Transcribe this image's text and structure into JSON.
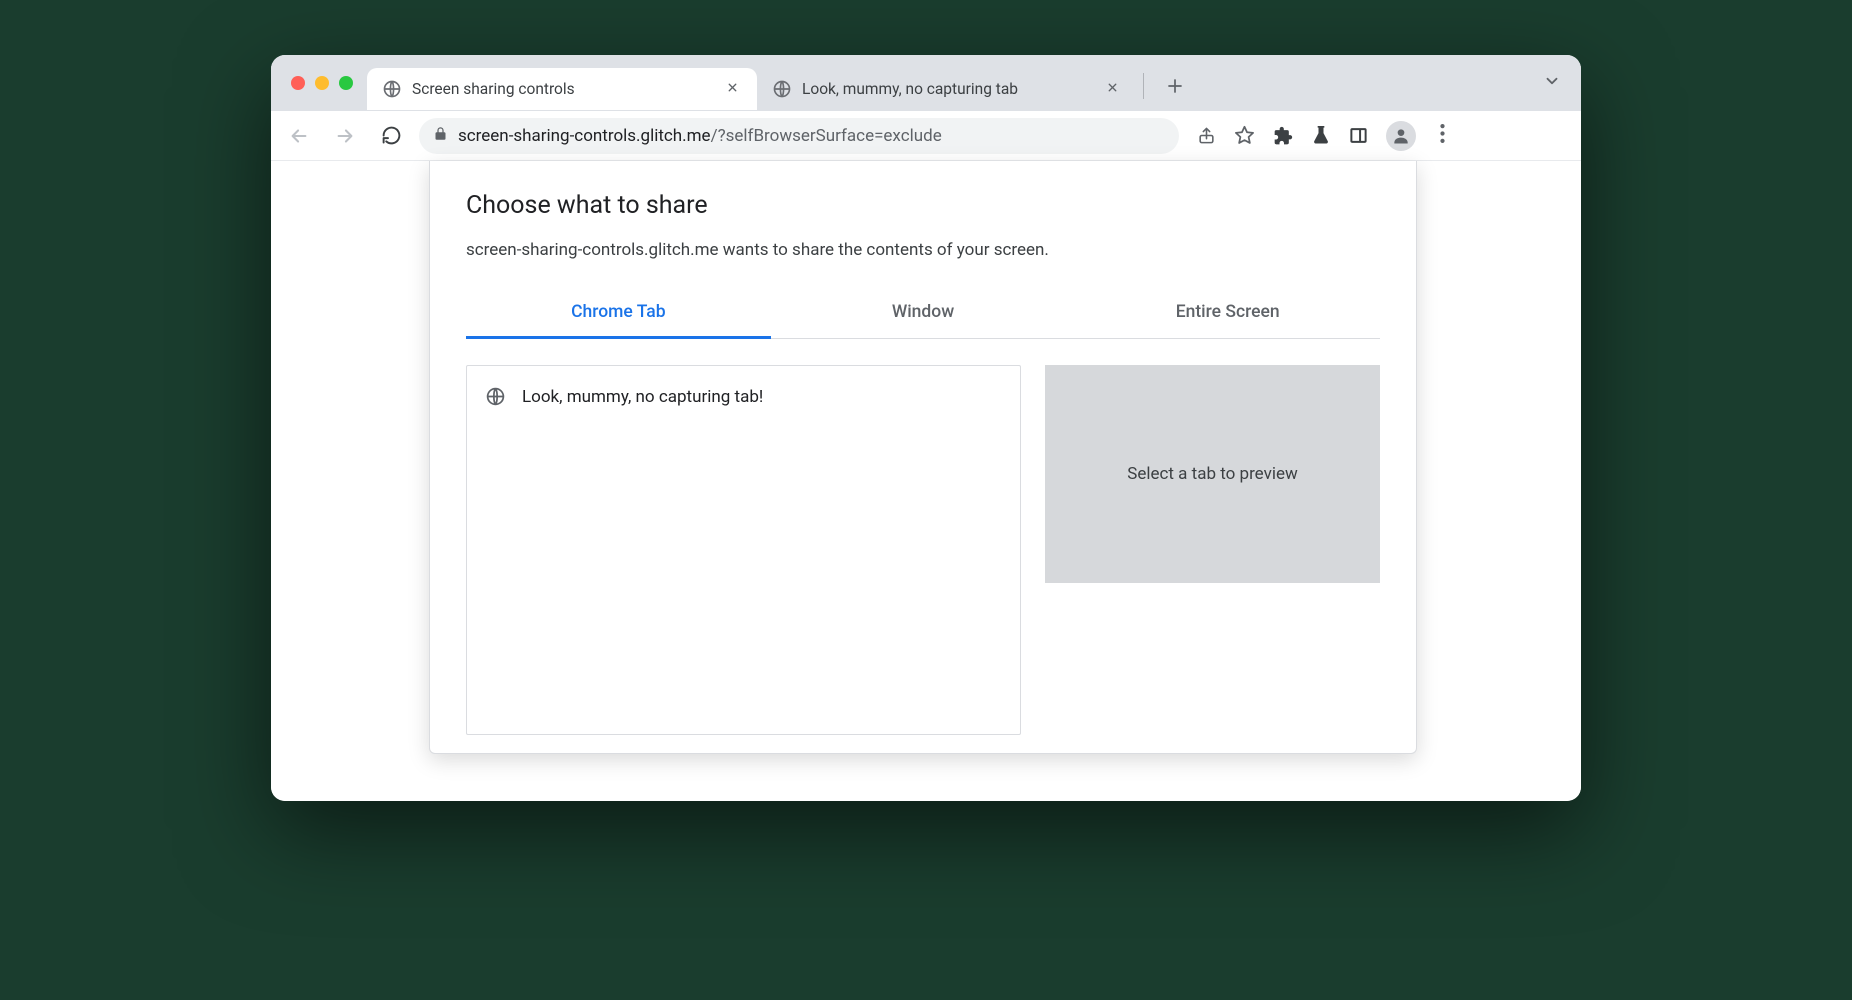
{
  "browser": {
    "tabs": [
      {
        "title": "Screen sharing controls",
        "active": true
      },
      {
        "title": "Look, mummy, no capturing tab",
        "active": false
      }
    ],
    "url_host": "screen-sharing-controls.glitch.me",
    "url_path": "/?selfBrowserSurface=exclude"
  },
  "dialog": {
    "title": "Choose what to share",
    "subtitle": "screen-sharing-controls.glitch.me wants to share the contents of your screen.",
    "tabs": {
      "chrome_tab": "Chrome Tab",
      "window": "Window",
      "entire_screen": "Entire Screen"
    },
    "tab_list": [
      {
        "title": "Look, mummy, no capturing tab!"
      }
    ],
    "preview_placeholder": "Select a tab to preview"
  }
}
